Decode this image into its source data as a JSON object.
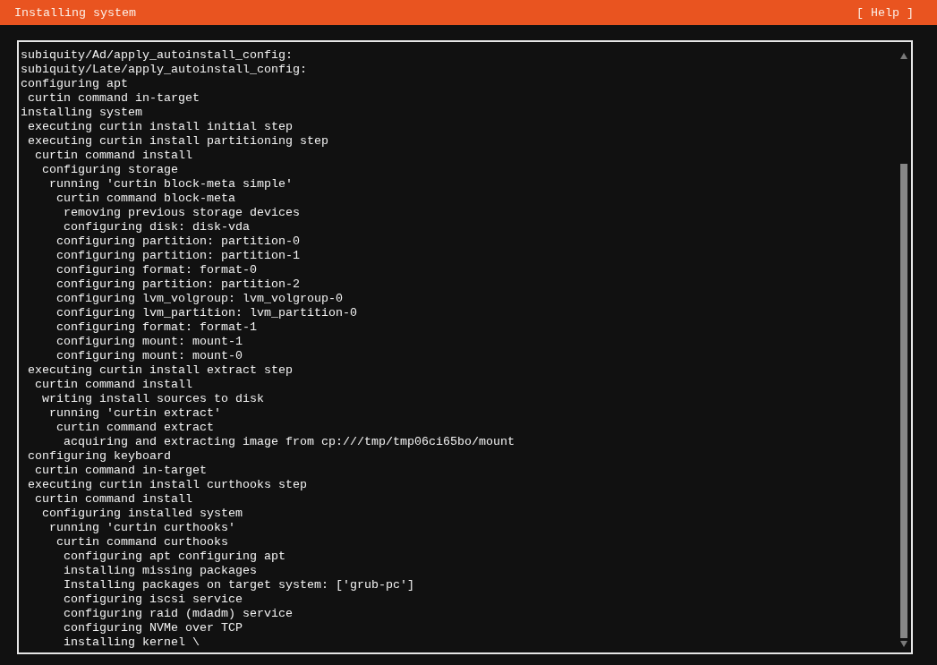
{
  "header": {
    "title": "Installing system",
    "help_button": "[ Help ]"
  },
  "log": {
    "lines": [
      {
        "text": "subiquity/Ad/apply_autoinstall_config:"
      },
      {
        "text": "subiquity/Late/apply_autoinstall_config:"
      },
      {
        "text": "configuring apt",
        "children": [
          {
            "text": "curtin command in-target"
          }
        ]
      },
      {
        "text": "installing system",
        "children": [
          {
            "text": "executing curtin install initial step"
          },
          {
            "text": "executing curtin install partitioning step",
            "children": [
              {
                "text": "curtin command install",
                "children": [
                  {
                    "text": "configuring storage",
                    "children": [
                      {
                        "text": "running 'curtin block-meta simple'",
                        "children": [
                          {
                            "text": "curtin command block-meta",
                            "children": [
                              {
                                "text": "removing previous storage devices"
                              },
                              {
                                "text": "configuring disk: disk-vda"
                              }
                            ]
                          },
                          {
                            "text": "configuring partition: partition-0"
                          },
                          {
                            "text": "configuring partition: partition-1"
                          },
                          {
                            "text": "configuring format: format-0"
                          },
                          {
                            "text": "configuring partition: partition-2"
                          },
                          {
                            "text": "configuring lvm_volgroup: lvm_volgroup-0"
                          },
                          {
                            "text": "configuring lvm_partition: lvm_partition-0"
                          },
                          {
                            "text": "configuring format: format-1"
                          },
                          {
                            "text": "configuring mount: mount-1"
                          },
                          {
                            "text": "configuring mount: mount-0"
                          }
                        ]
                      }
                    ]
                  }
                ]
              }
            ]
          },
          {
            "text": "executing curtin install extract step",
            "children": [
              {
                "text": "curtin command install",
                "children": [
                  {
                    "text": "writing install sources to disk",
                    "children": [
                      {
                        "text": "running 'curtin extract'",
                        "children": [
                          {
                            "text": "curtin command extract",
                            "children": [
                              {
                                "text": "acquiring and extracting image from cp:///tmp/tmp06ci65bo/mount"
                              }
                            ]
                          }
                        ]
                      }
                    ]
                  }
                ]
              }
            ]
          },
          {
            "text": "configuring keyboard",
            "children": [
              {
                "text": "curtin command in-target"
              }
            ]
          },
          {
            "text": "executing curtin install curthooks step",
            "children": [
              {
                "text": "curtin command install",
                "children": [
                  {
                    "text": "configuring installed system",
                    "children": [
                      {
                        "text": "running 'curtin curthooks'",
                        "children": [
                          {
                            "text": "curtin command curthooks",
                            "children": [
                              {
                                "text": "configuring apt configuring apt"
                              },
                              {
                                "text": "installing missing packages"
                              },
                              {
                                "text": "Installing packages on target system: ['grub-pc']"
                              },
                              {
                                "text": "configuring iscsi service"
                              },
                              {
                                "text": "configuring raid (mdadm) service"
                              },
                              {
                                "text": "configuring NVMe over TCP"
                              },
                              {
                                "text": "installing kernel \\"
                              }
                            ]
                          }
                        ]
                      }
                    ]
                  }
                ]
              }
            ]
          }
        ]
      }
    ]
  }
}
